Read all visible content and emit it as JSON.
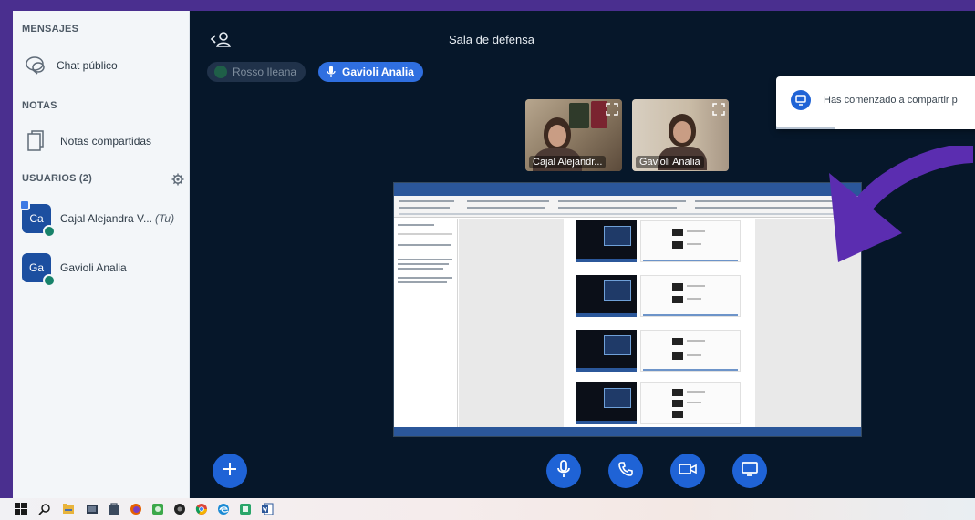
{
  "sidebar": {
    "messages_title": "MENSAJES",
    "public_chat_label": "Chat público",
    "notes_title": "NOTAS",
    "shared_notes_label": "Notas compartidas",
    "users_title": "USUARIOS (2)",
    "users": [
      {
        "initials": "Ca",
        "name": "Cajal Alejandra V...",
        "you_tag": "(Tu)",
        "avatar_color": "#1c4fa0"
      },
      {
        "initials": "Ga",
        "name": "Gavioli Analia",
        "you_tag": "",
        "avatar_color": "#1c4fa0"
      }
    ]
  },
  "header": {
    "title": "Sala de defensa"
  },
  "talkers": [
    {
      "name": "Rosso Ileana",
      "active": false
    },
    {
      "name": "Gavioli Analia",
      "active": true
    }
  ],
  "webcams": [
    {
      "label": "Cajal Alejandr..."
    },
    {
      "label": "Gavioli Analia"
    }
  ],
  "notification": {
    "text": "Has comenzado a compartir p"
  },
  "colors": {
    "frame": "#4a2f8f",
    "app_bg": "#06172a",
    "accent": "#1f63d6",
    "arrow": "#5b2db0"
  },
  "icons": {
    "back": "user-back-icon",
    "plus": "plus-icon",
    "mic": "microphone-icon",
    "phone": "phone-icon",
    "camera": "camera-icon",
    "screen": "screen-share-icon"
  }
}
